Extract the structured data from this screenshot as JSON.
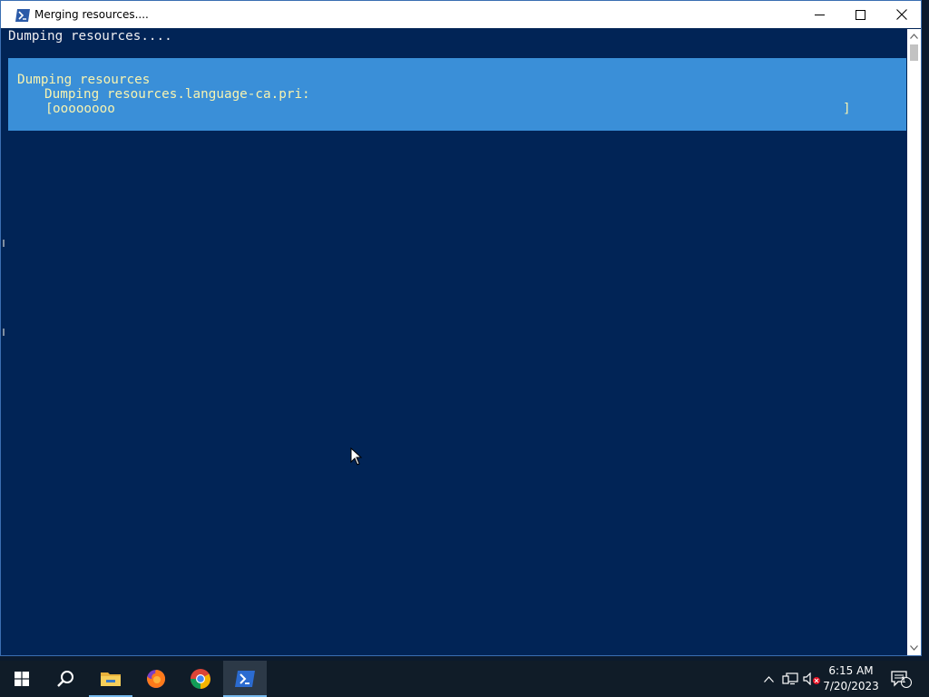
{
  "window": {
    "title": "Merging resources....",
    "icon": "powershell-icon",
    "controls": [
      "minimize-icon",
      "maximize-icon",
      "close-icon"
    ]
  },
  "console": {
    "lines": [
      "Dumping resources...."
    ],
    "progress": {
      "activity": "Dumping resources",
      "status": "Dumping resources.language-ca.pri:",
      "bar_open": "[",
      "bar_fill": "oooooooo",
      "bar_close": "]",
      "fraction": 0.09
    }
  },
  "taskbar": {
    "apps": [
      {
        "name": "start-button",
        "icon": "windows-logo-icon"
      },
      {
        "name": "search-button",
        "icon": "search-icon"
      },
      {
        "name": "file-explorer-button",
        "icon": "folder-icon"
      },
      {
        "name": "firefox-button",
        "icon": "firefox-icon"
      },
      {
        "name": "chrome-button",
        "icon": "chrome-icon"
      },
      {
        "name": "powershell-button",
        "icon": "powershell-icon",
        "active": true
      }
    ],
    "tray": [
      "chevron-up-icon",
      "network-icon",
      "volume-muted-icon",
      "notification-icon"
    ],
    "clock": {
      "time": "6:15 AM",
      "date": "7/20/2023"
    },
    "notification_count": "1"
  },
  "colors": {
    "console_bg": "#012456",
    "progress_bg": "#3a8fd8",
    "progress_text": "#f7f3b0",
    "taskbar_bg": "#101c28"
  }
}
